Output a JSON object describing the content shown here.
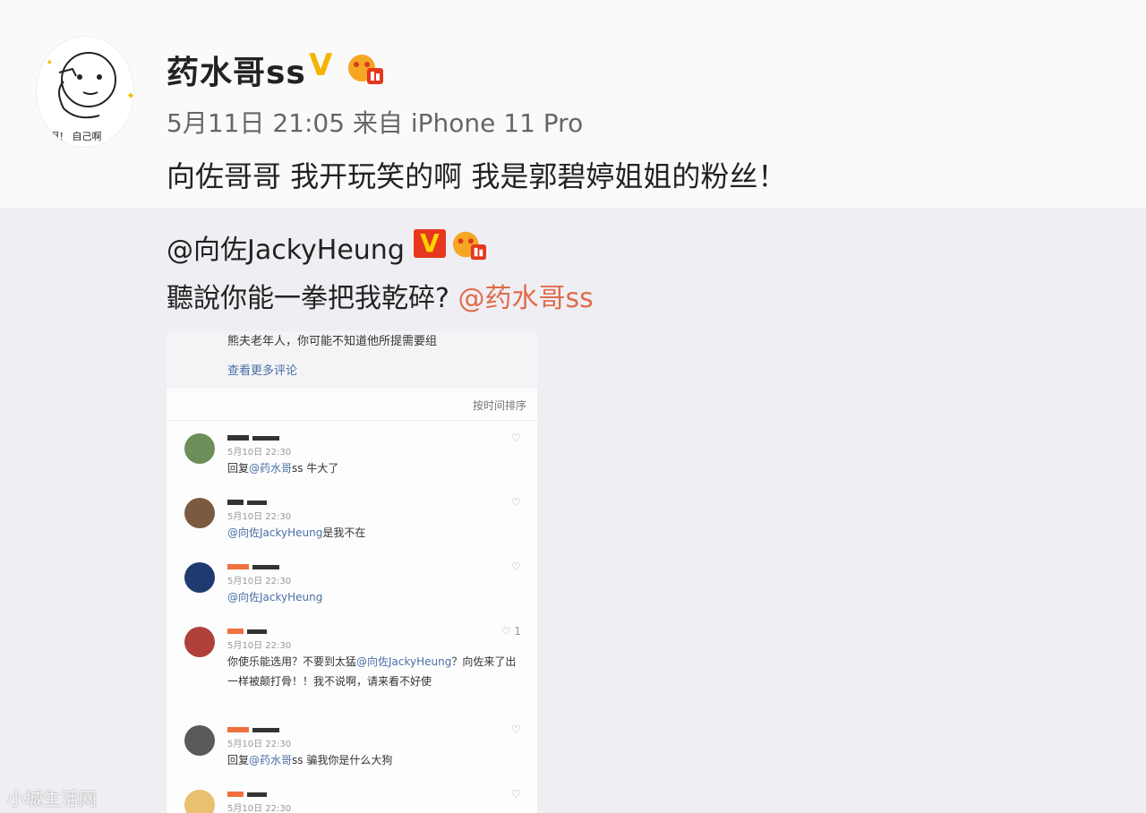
{
  "post": {
    "username": "药水哥ss",
    "verified_mark": "V",
    "meta": "5月11日 21:05 来自 iPhone 11 Pro",
    "content": "向佐哥哥 我开玩笑的啊 我是郭碧婷姐姐的粉丝！",
    "avatar_caption": "啊！ 自己啊"
  },
  "repost": {
    "user": "@向佐JackyHeung",
    "verified_mark": "V",
    "text": "聽說你能一拳把我乾碎?",
    "mention": "@药水哥ss"
  },
  "screenshot": {
    "top_line": "熊夫老年人，你可能不知道他所提需要组",
    "top_link": "查看更多评论",
    "sort_label": "按时间排序",
    "comments": [
      {
        "name": "",
        "time": "5月10日 22:30",
        "body_prefix": "回复",
        "body_link": "@药水哥",
        "body_rest": "ss 牛大了",
        "avatar_color": "#6c8f5a",
        "like": "♡"
      },
      {
        "name": "",
        "time": "5月10日 22:30",
        "body_prefix": "",
        "body_link": "@向佐JackyHeung",
        "body_rest": "是我不在",
        "avatar_color": "#7b5a40",
        "like": "♡"
      },
      {
        "name": "",
        "time": "5月10日 22:30",
        "body_prefix": "",
        "body_link": "@向佐JackyHeung",
        "body_rest": "",
        "avatar_color": "#1f3a6e",
        "like": "♡"
      },
      {
        "name": "",
        "time": "5月10日 22:30",
        "body_prefix": "你使乐能选用？不要到太猛",
        "body_link": "@向佐JackyHeung",
        "body_rest": "？向佐来了出一样被颠打骨！！我不说啊，请来看不好使",
        "avatar_color": "#b0403a",
        "like": "♡ 1"
      },
      {
        "name": "",
        "time": "5月10日 22:30",
        "body_prefix": "回复",
        "body_link": "@药水哥",
        "body_rest": "ss 骗我你是什么大狗",
        "avatar_color": "#5a5a5a",
        "like": "♡"
      },
      {
        "name": "",
        "time": "5月10日 22:30",
        "body_prefix": "",
        "body_link": "",
        "body_rest": "",
        "avatar_color": "#e8c070",
        "like": "♡"
      }
    ]
  },
  "watermark": "小城生活网",
  "colors": {
    "accent_link": "#4a6fa5",
    "mention": "#e06c4c",
    "vip_gold": "#f5b400",
    "v_red": "#e6371e"
  }
}
